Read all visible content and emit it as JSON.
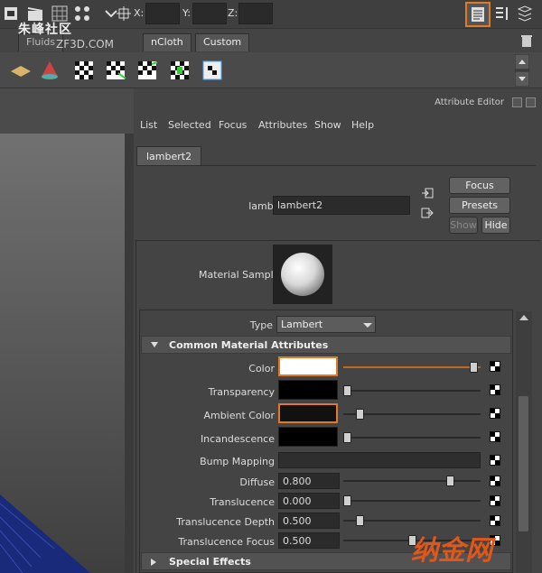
{
  "toolbar": {
    "coords": [
      {
        "label": "X:"
      },
      {
        "label": "Y:"
      },
      {
        "label": "Z:"
      }
    ],
    "accent_color": "#e07a25"
  },
  "shelf": {
    "tabs": [
      {
        "label": "Fluids"
      },
      {
        "label": "nCloth"
      },
      {
        "label": "Custom"
      }
    ],
    "watermark": "朱峰社区",
    "watermark_sub": "ZF3D.COM"
  },
  "attribute_editor": {
    "title": "Attribute Editor",
    "menu": [
      "List",
      "Selected",
      "Focus",
      "Attributes",
      "Show",
      "Help"
    ],
    "node_tab": "lambert2",
    "node_type_label": "lambert:",
    "node_name": "lambert2",
    "buttons": {
      "focus": "Focus",
      "presets": "Presets",
      "show": "Show",
      "hide": "Hide"
    },
    "material_sample_label": "Material Sample",
    "type_label": "Type",
    "type_value": "Lambert",
    "sections": {
      "common": "Common Material Attributes",
      "special": "Special Effects"
    },
    "attributes": {
      "color": {
        "label": "Color",
        "swatch": "#ffffff",
        "level": 0.98
      },
      "transparency": {
        "label": "Transparency",
        "swatch": "#000000",
        "level": 0.0
      },
      "ambient": {
        "label": "Ambient Color",
        "swatch": "#111111",
        "level": 0.1
      },
      "incandescence": {
        "label": "Incandescence",
        "swatch": "#000000",
        "level": 0.0
      },
      "bump": {
        "label": "Bump Mapping"
      },
      "diffuse": {
        "label": "Diffuse",
        "value": "0.800",
        "level": 0.8
      },
      "translucence": {
        "label": "Translucence",
        "value": "0.000",
        "level": 0.0
      },
      "translucence_depth": {
        "label": "Translucence Depth",
        "value": "0.500",
        "level": 0.1
      },
      "translucence_focus": {
        "label": "Translucence Focus",
        "value": "0.500",
        "level": 0.5
      }
    }
  },
  "watermark_bottom": "纳金网"
}
